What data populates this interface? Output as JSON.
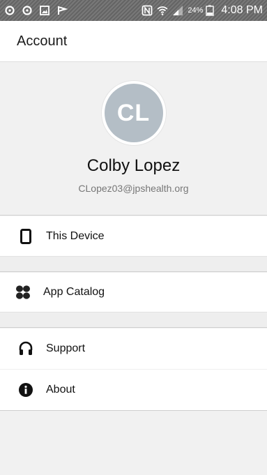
{
  "status_bar": {
    "battery_percent": "24%",
    "time": "4:08 PM",
    "icons": [
      "sync-icon",
      "sync-icon",
      "image-icon",
      "flag-icon",
      "nfc-icon",
      "wifi-icon",
      "signal-icon",
      "battery-icon"
    ]
  },
  "header": {
    "title": "Account"
  },
  "profile": {
    "initials": "CL",
    "name": "Colby Lopez",
    "email": "CLopez03@jpshealth.org"
  },
  "menu": {
    "device": {
      "label": "This Device",
      "icon": "phone-icon"
    },
    "catalog": {
      "label": "App Catalog",
      "icon": "grid-icon"
    },
    "support": {
      "label": "Support",
      "icon": "headphones-icon"
    },
    "about": {
      "label": "About",
      "icon": "info-icon"
    }
  },
  "colors": {
    "avatar_bg": "#b4bec6",
    "page_bg": "#f1f1f1",
    "status_bar": "#6d6d6d"
  }
}
